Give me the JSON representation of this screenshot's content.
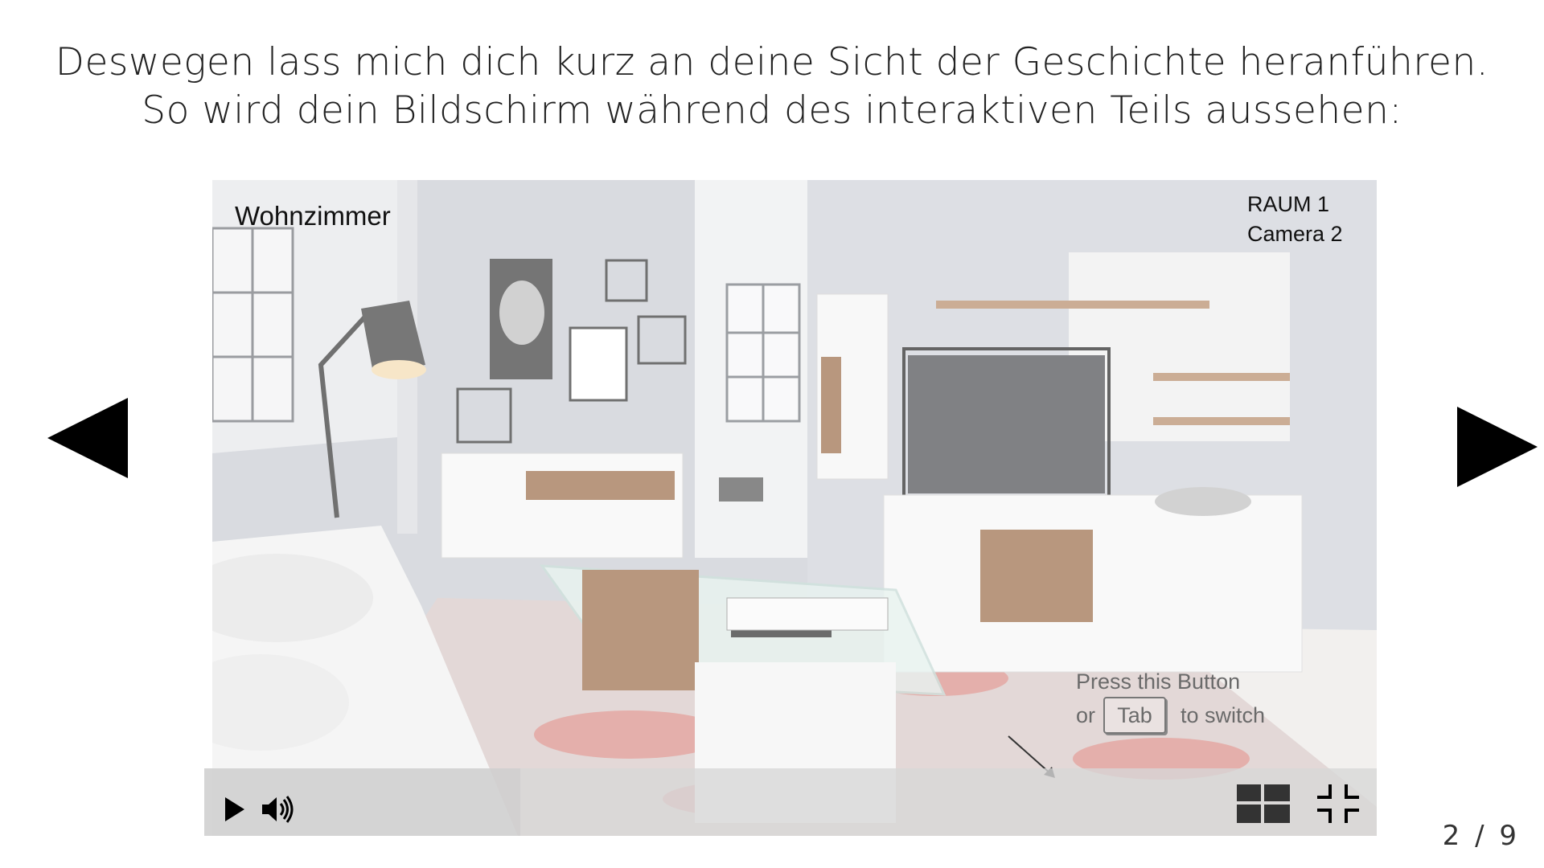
{
  "headline": {
    "line1": "Deswegen lass mich dich kurz an deine Sicht der Geschichte heranführen.",
    "line2": "So wird dein Bildschirm während des interaktiven Teils aussehen:"
  },
  "viewer": {
    "room_name": "Wohnzimmer",
    "room_label": "RAUM 1",
    "camera_label": "Camera 2",
    "hint_line1": "Press this Button",
    "hint_or": "or",
    "hint_key": "Tab",
    "hint_to_switch": "to switch"
  },
  "controls": {
    "play_icon": "play-icon",
    "volume_icon": "volume-icon",
    "grid_icon": "grid-view-icon",
    "exit_fullscreen_icon": "exit-fullscreen-icon"
  },
  "navigation": {
    "prev_icon": "arrow-left-icon",
    "next_icon": "arrow-right-icon"
  },
  "pagination": {
    "text": "2 / 9"
  },
  "colors": {
    "background": "#ffffff",
    "arrow": "#000000",
    "wall": "#c9ccd3",
    "wood": "#9a6b47",
    "rug_red": "#d9665e"
  }
}
